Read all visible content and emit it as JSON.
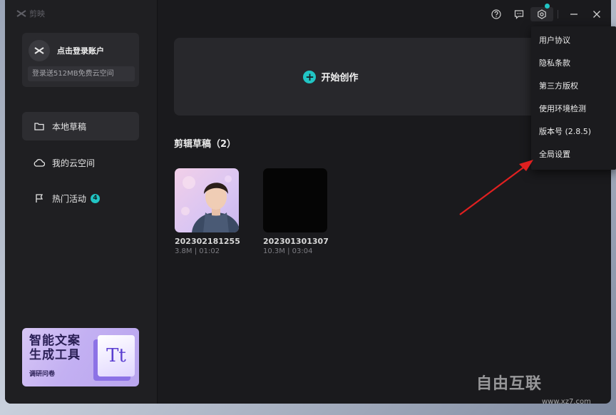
{
  "app": {
    "name": "剪映"
  },
  "account": {
    "login_label": "点击登录账户",
    "promo_label": "登录送512MB免费云空间"
  },
  "nav": {
    "items": [
      {
        "label": "本地草稿",
        "icon": "folder-icon",
        "active": true
      },
      {
        "label": "我的云空间",
        "icon": "cloud-icon",
        "active": false
      },
      {
        "label": "热门活动",
        "icon": "flag-icon",
        "active": false,
        "badge": "4"
      }
    ]
  },
  "promo_banner": {
    "line1": "智能文案",
    "line2": "生成工具",
    "sub": "调研问卷",
    "glyph": "Tt"
  },
  "titlebar": {
    "icons": [
      "help-icon",
      "feedback-icon",
      "settings-icon",
      "minimize-icon",
      "close-icon"
    ]
  },
  "main": {
    "create_label": "开始创作",
    "drafts_title": "剪辑草稿（2）",
    "drafts": [
      {
        "name": "202302181255",
        "meta": "3.8M | 01:02"
      },
      {
        "name": "202301301307",
        "meta": "10.3M | 03:04"
      }
    ]
  },
  "settings_menu": {
    "items": [
      "用户协议",
      "隐私条款",
      "第三方版权",
      "使用环境检测",
      "版本号 (2.8.5)",
      "全局设置"
    ]
  },
  "colors": {
    "accent": "#21c5c4",
    "background": "#1a1a1d",
    "arrow": "#e02020"
  },
  "watermark": {
    "brand": "自由互联",
    "url": "www.xz7.com"
  }
}
